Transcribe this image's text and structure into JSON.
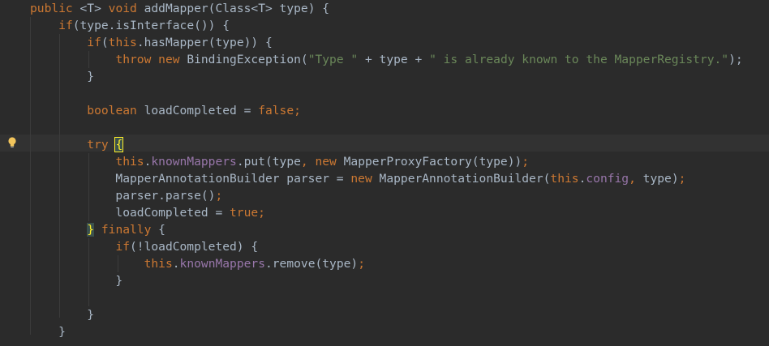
{
  "editor": {
    "lines": [
      {
        "parts": [
          {
            "t": "public ",
            "c": "kw"
          },
          {
            "t": "<T> "
          },
          {
            "t": "void ",
            "c": "kw"
          },
          {
            "t": "addMapper(Class<T> type) {"
          }
        ]
      },
      {
        "parts": [
          {
            "t": "    "
          },
          {
            "t": "if",
            "c": "kw"
          },
          {
            "t": "(type.isInterface()) {"
          }
        ]
      },
      {
        "parts": [
          {
            "t": "        "
          },
          {
            "t": "if",
            "c": "kw"
          },
          {
            "t": "("
          },
          {
            "t": "this",
            "c": "kw"
          },
          {
            "t": ".hasMapper(type)) {"
          }
        ]
      },
      {
        "parts": [
          {
            "t": "            "
          },
          {
            "t": "throw new ",
            "c": "kw"
          },
          {
            "t": "BindingException("
          },
          {
            "t": "\"Type \"",
            "c": "str"
          },
          {
            "t": " + type + "
          },
          {
            "t": "\" is already known to the MapperRegistry.\"",
            "c": "str"
          },
          {
            "t": ");"
          }
        ]
      },
      {
        "parts": [
          {
            "t": "        }"
          }
        ]
      },
      {
        "parts": [
          {
            "t": ""
          }
        ]
      },
      {
        "parts": [
          {
            "t": "        "
          },
          {
            "t": "boolean ",
            "c": "kw"
          },
          {
            "t": "loadCompleted = "
          },
          {
            "t": "false",
            "c": "kw"
          },
          {
            "t": ";",
            "c": "kw"
          }
        ]
      },
      {
        "parts": [
          {
            "t": ""
          }
        ]
      },
      {
        "parts": [
          {
            "t": "        "
          },
          {
            "t": "try ",
            "c": "kw"
          },
          {
            "t": "{",
            "c": "brace-hl"
          }
        ]
      },
      {
        "parts": [
          {
            "t": "            "
          },
          {
            "t": "this",
            "c": "kw"
          },
          {
            "t": "."
          },
          {
            "t": "knownMappers",
            "c": "fld"
          },
          {
            "t": ".put(type"
          },
          {
            "t": ", ",
            "c": "kw"
          },
          {
            "t": "new ",
            "c": "kw"
          },
          {
            "t": "MapperProxyFactory(type))"
          },
          {
            "t": ";",
            "c": "kw"
          }
        ]
      },
      {
        "parts": [
          {
            "t": "            MapperAnnotationBuilder parser = "
          },
          {
            "t": "new ",
            "c": "kw"
          },
          {
            "t": "MapperAnnotationBuilder("
          },
          {
            "t": "this",
            "c": "kw"
          },
          {
            "t": "."
          },
          {
            "t": "config",
            "c": "fld"
          },
          {
            "t": ", ",
            "c": "kw"
          },
          {
            "t": "type)"
          },
          {
            "t": ";",
            "c": "kw"
          }
        ]
      },
      {
        "parts": [
          {
            "t": "            parser.parse()"
          },
          {
            "t": ";",
            "c": "kw"
          }
        ]
      },
      {
        "parts": [
          {
            "t": "            loadCompleted = "
          },
          {
            "t": "true",
            "c": "kw"
          },
          {
            "t": ";",
            "c": "kw"
          }
        ]
      },
      {
        "parts": [
          {
            "t": "        "
          },
          {
            "t": "}",
            "c": "brace-match"
          },
          {
            "t": " finally ",
            "c": "kw"
          },
          {
            "t": "{"
          }
        ]
      },
      {
        "parts": [
          {
            "t": "            "
          },
          {
            "t": "if",
            "c": "kw"
          },
          {
            "t": "(!loadCompleted) {"
          }
        ]
      },
      {
        "parts": [
          {
            "t": "                "
          },
          {
            "t": "this",
            "c": "kw"
          },
          {
            "t": "."
          },
          {
            "t": "knownMappers",
            "c": "fld"
          },
          {
            "t": ".remove(type)"
          },
          {
            "t": ";",
            "c": "kw"
          }
        ]
      },
      {
        "parts": [
          {
            "t": "            }"
          }
        ]
      },
      {
        "parts": [
          {
            "t": ""
          }
        ]
      },
      {
        "parts": [
          {
            "t": "        }"
          }
        ]
      },
      {
        "parts": [
          {
            "t": "    }"
          }
        ]
      }
    ],
    "current_line_index": 8,
    "intention_icon": "lightbulb-icon",
    "colors": {
      "background": "#2b2b2b",
      "text": "#a9b7c6",
      "keyword": "#cc7832",
      "string": "#6a8759",
      "field": "#9876aa",
      "brace_highlight": "#ffef28"
    }
  }
}
